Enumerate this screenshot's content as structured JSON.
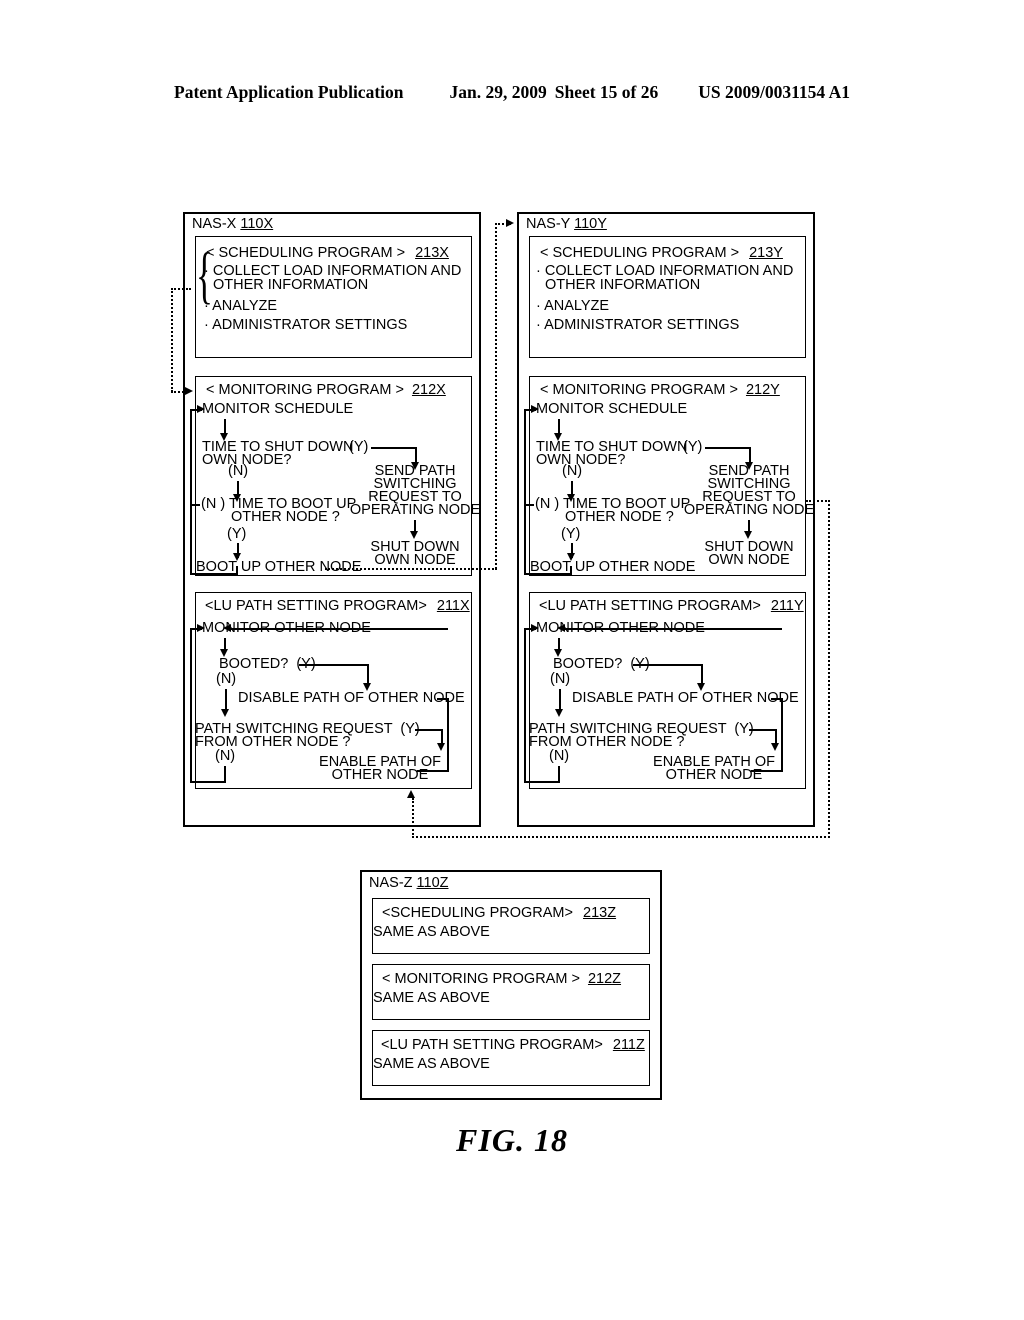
{
  "header": {
    "publication": "Patent Application Publication",
    "date": "Jan. 29, 2009",
    "sheet": "Sheet 15 of 26",
    "patent_number": "US 2009/0031154 A1"
  },
  "figure_caption": "FIG. 18",
  "nodes": [
    {
      "id": "nas-x",
      "name": "NAS-X",
      "ref": "110X",
      "programs": [
        {
          "id": "scheduling",
          "title_open": "<",
          "title": " SCHEDULING PROGRAM ",
          "title_close": ">",
          "ref": "213X",
          "items": [
            "COLLECT LOAD INFORMATION AND",
            "OTHER INFORMATION",
            "ANALYZE",
            "ADMINISTRATOR SETTINGS"
          ]
        },
        {
          "id": "monitoring",
          "title_open": "<",
          "title": " MONITORING PROGRAM ",
          "title_close": ">",
          "ref": "212X",
          "steps": {
            "monitor_schedule": "MONITOR SCHEDULE",
            "shutdown_q_l1": "TIME TO SHUT DOWN",
            "shutdown_q_l2": "OWN NODE?",
            "shutdown_yes": "(Y)",
            "shutdown_no": "(N)",
            "bootup_q_no": "(N )",
            "bootup_q_l1": "TIME TO BOOT UP",
            "bootup_q_l2": "OTHER NODE ?",
            "bootup_yes": "(Y)",
            "boot_up_other_node": "BOOT UP OTHER NODE",
            "send_path_l1": "SEND PATH",
            "send_path_l2": "SWITCHING",
            "send_path_l3": "REQUEST TO",
            "send_path_l4": "OPERATING NODE",
            "shut_down_l1": "SHUT DOWN",
            "shut_down_l2": "OWN NODE"
          }
        },
        {
          "id": "lu-path",
          "title_open": "<",
          "title": "LU PATH SETTING PROGRAM",
          "title_close": ">",
          "ref": "211X",
          "steps": {
            "monitor_other_node": "MONITOR OTHER NODE",
            "booted_q": "BOOTED?",
            "booted_yes": "(Y)",
            "booted_no": "(N)",
            "disable_path": "DISABLE PATH OF OTHER NODE",
            "psr_l1": "PATH SWITCHING REQUEST",
            "psr_l2": "FROM OTHER NODE ?",
            "psr_yes": "(Y)",
            "psr_no": "(N)",
            "enable_path_l1": "ENABLE PATH OF",
            "enable_path_l2": "OTHER NODE"
          }
        }
      ]
    },
    {
      "id": "nas-y",
      "name": "NAS-Y",
      "ref": "110Y",
      "programs": [
        {
          "id": "scheduling",
          "title_open": "<",
          "title": " SCHEDULING PROGRAM ",
          "title_close": ">",
          "ref": "213Y",
          "items": [
            "COLLECT LOAD INFORMATION AND",
            "OTHER INFORMATION",
            "ANALYZE",
            "ADMINISTRATOR SETTINGS"
          ]
        },
        {
          "id": "monitoring",
          "title_open": "<",
          "title": " MONITORING PROGRAM ",
          "title_close": ">",
          "ref": "212Y",
          "steps": {
            "monitor_schedule": "MONITOR SCHEDULE",
            "shutdown_q_l1": "TIME TO SHUT DOWN",
            "shutdown_q_l2": "OWN NODE?",
            "shutdown_yes": "(Y)",
            "shutdown_no": "(N)",
            "bootup_q_no": "(N )",
            "bootup_q_l1": "TIME TO BOOT UP",
            "bootup_q_l2": "OTHER NODE ?",
            "bootup_yes": "(Y)",
            "boot_up_other_node": "BOOT UP OTHER NODE",
            "send_path_l1": "SEND PATH",
            "send_path_l2": "SWITCHING",
            "send_path_l3": "REQUEST TO",
            "send_path_l4": "OPERATING NODE",
            "shut_down_l1": "SHUT DOWN",
            "shut_down_l2": "OWN NODE"
          }
        },
        {
          "id": "lu-path",
          "title_open": "<",
          "title": "LU PATH SETTING PROGRAM",
          "title_close": ">",
          "ref": "211Y",
          "steps": {
            "monitor_other_node": "MONITOR OTHER NODE",
            "booted_q": "BOOTED?",
            "booted_yes": "(Y)",
            "booted_no": "(N)",
            "disable_path": "DISABLE PATH OF OTHER NODE",
            "psr_l1": "PATH SWITCHING REQUEST",
            "psr_l2": "FROM OTHER NODE ?",
            "psr_yes": "(Y)",
            "psr_no": "(N)",
            "enable_path_l1": "ENABLE PATH OF",
            "enable_path_l2": "OTHER NODE"
          }
        }
      ]
    },
    {
      "id": "nas-z",
      "name": "NAS-Z",
      "ref": "110Z",
      "programs": [
        {
          "id": "scheduling",
          "title_open": "<",
          "title": "SCHEDULING PROGRAM",
          "title_close": ">",
          "ref": "213Z",
          "body": "SAME AS ABOVE"
        },
        {
          "id": "monitoring",
          "title_open": "<",
          "title": " MONITORING PROGRAM ",
          "title_close": ">",
          "ref": "212Z",
          "body": "SAME AS ABOVE"
        },
        {
          "id": "lu-path",
          "title_open": "<",
          "title": "LU PATH SETTING PROGRAM",
          "title_close": ">",
          "ref": "211Z",
          "body": "SAME AS ABOVE"
        }
      ]
    }
  ]
}
